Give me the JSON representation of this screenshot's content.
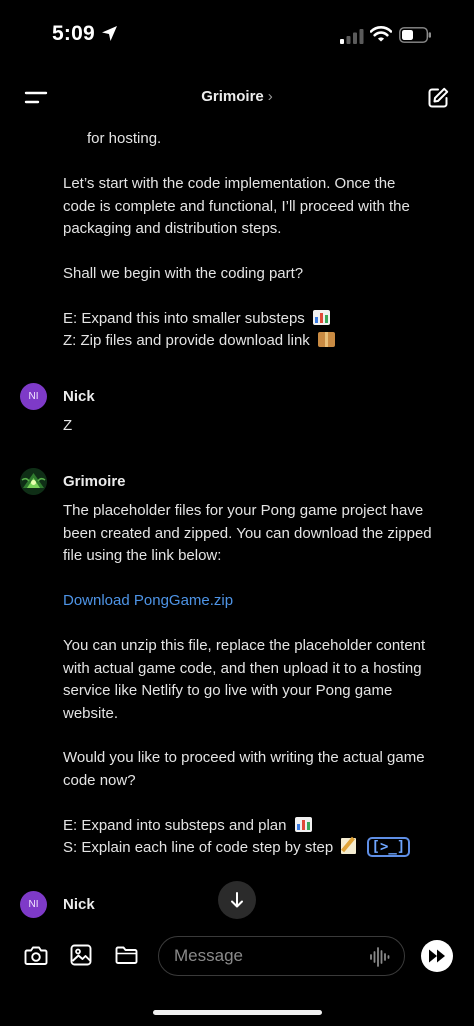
{
  "status_bar": {
    "time": "5:09"
  },
  "nav": {
    "title": "Grimoire",
    "chevron": "›"
  },
  "messages": {
    "partial": {
      "line1": "for hosting.",
      "para1_l1": "Let’s start with the code implementation. Once the",
      "para1_l2": "code is complete and functional, I’ll proceed with the",
      "para1_l3": "packaging and distribution steps.",
      "para2": "Shall we begin with the coding part?",
      "opt_e": "E: Expand this into smaller substeps",
      "opt_z": "Z: Zip files and provide download link"
    },
    "nick1": {
      "initials": "NI",
      "name": "Nick",
      "text": "Z"
    },
    "grimoire": {
      "name": "Grimoire",
      "p1_l1": "The placeholder files for your Pong game project have",
      "p1_l2": "been created and zipped. You can download the zipped",
      "p1_l3": "file using the link below:",
      "link": "Download PongGame.zip",
      "p2_l1": "You can unzip this file, replace the placeholder content",
      "p2_l2": "with actual game code, and then upload it to a hosting",
      "p2_l3": "service like Netlify to go live with your Pong game",
      "p2_l4": "website.",
      "p3_l1": "Would you like to proceed with writing the actual game",
      "p3_l2": "code now?",
      "opt_e": "E: Expand into substeps and plan",
      "opt_s": "S: Explain each line of code step by step",
      "code_icon_text": "[>_]"
    },
    "nick2": {
      "initials": "NI",
      "name": "Nick"
    }
  },
  "composer": {
    "placeholder": "Message"
  },
  "icons": {
    "menu": "menu-icon",
    "edit": "edit-icon",
    "camera": "camera-icon",
    "photo": "photo-icon",
    "folder": "folder-icon",
    "voice": "voice-icon",
    "send": "send-icon",
    "scroll": "arrow-down-icon"
  },
  "colors": {
    "background": "#000000",
    "link": "#4e94e6",
    "avatar": "#7e3ac8",
    "text": "#e4e4e4"
  }
}
